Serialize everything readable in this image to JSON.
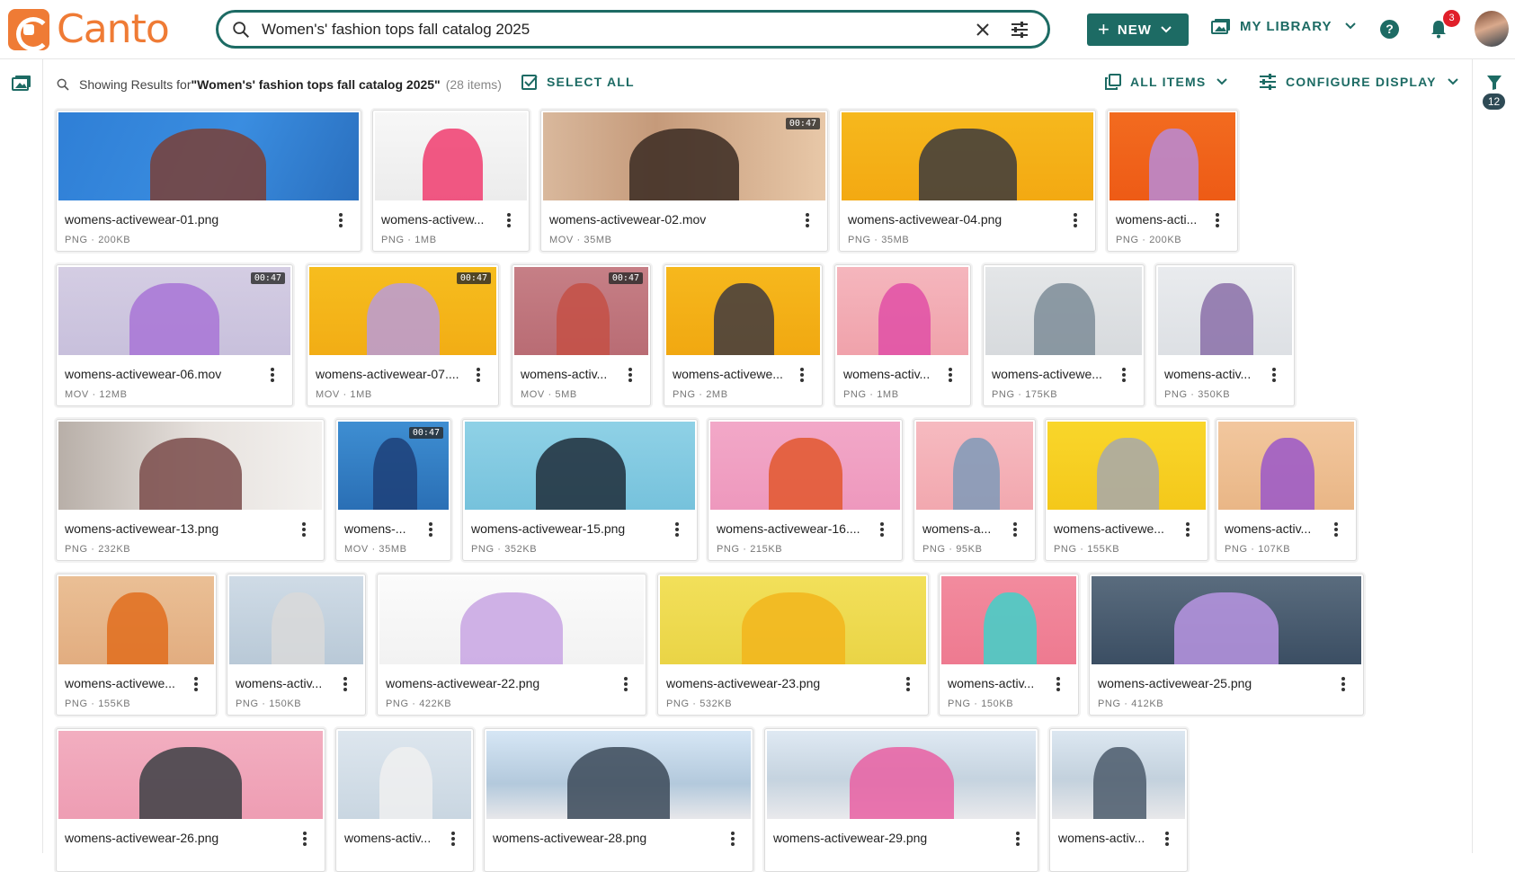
{
  "app": {
    "name": "Canto"
  },
  "search": {
    "value": "Women's' fashion tops fall catalog 2025",
    "placeholder": ""
  },
  "header": {
    "new_label": "NEW",
    "my_library_label": "MY LIBRARY",
    "notification_count": "3"
  },
  "results": {
    "prefix": "Showing Results for ",
    "query": "\"Women's' fashion tops fall catalog 2025\"",
    "count_text": "(28 items)",
    "select_all_label": "SELECT ALL",
    "all_items_label": "ALL ITEMS",
    "configure_display_label": "CONFIGURE DISPLAY"
  },
  "filter_count": "12",
  "colors": {
    "accent": "#1d6b64",
    "brand": "#ef7b35",
    "badge": "#e01f2a"
  },
  "items": [
    {
      "name": "womens-activewear-01.png",
      "meta": "PNG · 200KB",
      "duration": ""
    },
    {
      "name": "womens-activewear-03.png",
      "display_name": "womens-activew...",
      "meta": "PNG · 1MB",
      "duration": ""
    },
    {
      "name": "womens-activewear-02.mov",
      "meta": "MOV · 35MB",
      "duration": "00:47"
    },
    {
      "name": "womens-activewear-04.png",
      "meta": "PNG · 35MB",
      "duration": ""
    },
    {
      "name": "womens-activewear-05.png",
      "display_name": "womens-acti...",
      "meta": "PNG · 200KB",
      "duration": ""
    },
    {
      "name": "womens-activewear-06.mov",
      "meta": "MOV · 12MB",
      "duration": "00:47"
    },
    {
      "name": "womens-activewear-07.mov",
      "display_name": "womens-activewear-07....",
      "meta": "MOV · 1MB",
      "duration": "00:47"
    },
    {
      "name": "womens-activewear-08.mov",
      "display_name": "womens-activ...",
      "meta": "MOV · 5MB",
      "duration": "00:47"
    },
    {
      "name": "womens-activewear-09.png",
      "display_name": "womens-activewe...",
      "meta": "PNG · 2MB",
      "duration": ""
    },
    {
      "name": "womens-activewear-10.png",
      "display_name": "womens-activ...",
      "meta": "PNG · 1MB",
      "duration": ""
    },
    {
      "name": "womens-activewear-11.png",
      "display_name": "womens-activewe...",
      "meta": "PNG · 175KB",
      "duration": ""
    },
    {
      "name": "womens-activewear-12.png",
      "display_name": "womens-activ...",
      "meta": "PNG · 350KB",
      "duration": ""
    },
    {
      "name": "womens-activewear-13.png",
      "meta": "PNG · 232KB",
      "duration": ""
    },
    {
      "name": "womens-activewear-14.mov",
      "display_name": "womens-...",
      "meta": "MOV · 35MB",
      "duration": "00:47"
    },
    {
      "name": "womens-activewear-15.png",
      "meta": "PNG · 352KB",
      "duration": ""
    },
    {
      "name": "womens-activewear-16.png",
      "display_name": "womens-activewear-16....",
      "meta": "PNG · 215KB",
      "duration": ""
    },
    {
      "name": "womens-activewear-17.png",
      "display_name": "womens-a...",
      "meta": "PNG · 95KB",
      "duration": ""
    },
    {
      "name": "womens-activewear-18.png",
      "display_name": "womens-activewe...",
      "meta": "PNG · 155KB",
      "duration": ""
    },
    {
      "name": "womens-activewear-19.png",
      "display_name": "womens-activ...",
      "meta": "PNG · 107KB",
      "duration": ""
    },
    {
      "name": "womens-activewear-20.png",
      "display_name": "womens-activewe...",
      "meta": "PNG · 155KB",
      "duration": ""
    },
    {
      "name": "womens-activewear-21.png",
      "display_name": "womens-activ...",
      "meta": "PNG · 150KB",
      "duration": ""
    },
    {
      "name": "womens-activewear-22.png",
      "meta": "PNG · 422KB",
      "duration": ""
    },
    {
      "name": "womens-activewear-23.png",
      "meta": "PNG · 532KB",
      "duration": ""
    },
    {
      "name": "womens-activewear-24.png",
      "display_name": "womens-activ...",
      "meta": "PNG · 150KB",
      "duration": ""
    },
    {
      "name": "womens-activewear-25.png",
      "meta": "PNG · 412KB",
      "duration": ""
    },
    {
      "name": "womens-activewear-26.png",
      "meta": "",
      "duration": ""
    },
    {
      "name": "womens-activewear-27.png",
      "display_name": "womens-activ...",
      "meta": "",
      "duration": ""
    },
    {
      "name": "womens-activewear-28.png",
      "meta": "",
      "duration": ""
    },
    {
      "name": "womens-activewear-29.png",
      "meta": "",
      "duration": ""
    },
    {
      "name": "womens-activewear-30.png",
      "display_name": "womens-activ...",
      "meta": "",
      "duration": ""
    }
  ]
}
